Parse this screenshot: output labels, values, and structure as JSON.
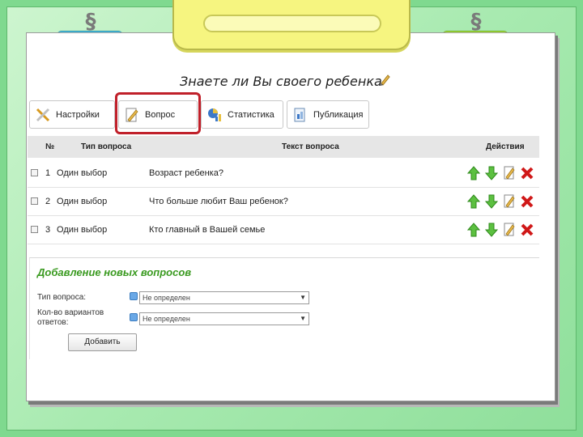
{
  "page": {
    "title": "Знаете ли Вы своего ребенка"
  },
  "toolbar": {
    "settings_label": "Настройки",
    "question_label": "Вопрос",
    "statistics_label": "Статистика",
    "publish_label": "Публикация"
  },
  "table": {
    "headers": {
      "num": "№",
      "type": "Тип вопроса",
      "text": "Текст вопроса",
      "actions": "Действия"
    },
    "rows": [
      {
        "num": "1",
        "type": "Один выбор",
        "text": "Возраст ребенка?"
      },
      {
        "num": "2",
        "type": "Один выбор",
        "text": "Что больше любит Ваш ребенок?"
      },
      {
        "num": "3",
        "type": "Один выбор",
        "text": "Кто главный в Вашей семье"
      }
    ]
  },
  "add_form": {
    "title": "Добавление новых вопросов",
    "question_type_label": "Тип вопроса:",
    "question_type_value": "Не определен",
    "answers_count_label_1": "Кол-во вариантов",
    "answers_count_label_2": "ответов:",
    "answers_count_value": "Не определен",
    "add_button_label": "Добавить"
  },
  "colors": {
    "background": "#7fd98f",
    "accent_green": "#3a9a20",
    "highlight": "#c0202a",
    "clip_yellow": "#f6f580",
    "tab_blue": "#2eb4dc",
    "tab_green": "#8fd826"
  },
  "icons": {
    "settings": "tools-icon",
    "question": "edit-document-icon",
    "statistics": "chart-icon",
    "publish": "publish-icon",
    "move_up": "arrow-up-icon",
    "move_down": "arrow-down-icon",
    "edit": "edit-icon",
    "delete": "delete-icon"
  }
}
